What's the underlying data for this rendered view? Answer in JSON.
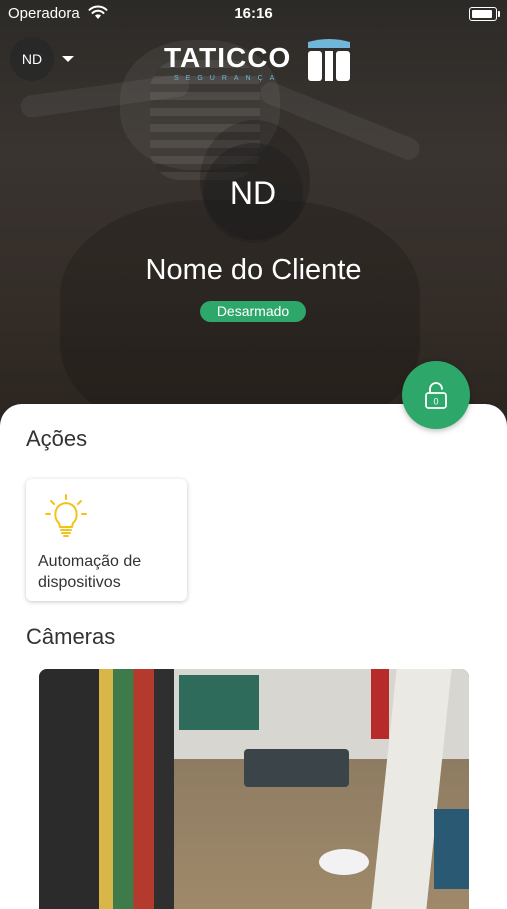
{
  "status_bar": {
    "carrier": "Operadora",
    "time": "16:16",
    "icons": [
      "wifi-icon",
      "battery-icon"
    ]
  },
  "header": {
    "account_initials": "ND",
    "logo_text": "TATICCO",
    "logo_subtext": "SEGURANÇA"
  },
  "profile": {
    "initials": "ND",
    "client_name": "Nome do Cliente",
    "status": "Desarmado"
  },
  "fab": {
    "icon": "lock-open-icon",
    "label": "0"
  },
  "actions": {
    "title": "Ações",
    "items": [
      {
        "icon": "lightbulb-icon",
        "label": "Automação de dispositivos"
      }
    ]
  },
  "cameras": {
    "title": "Câmeras"
  },
  "colors": {
    "accent_green": "#2ea86a",
    "bulb_yellow": "#f2c318",
    "logo_blue": "#6fb6d8"
  }
}
